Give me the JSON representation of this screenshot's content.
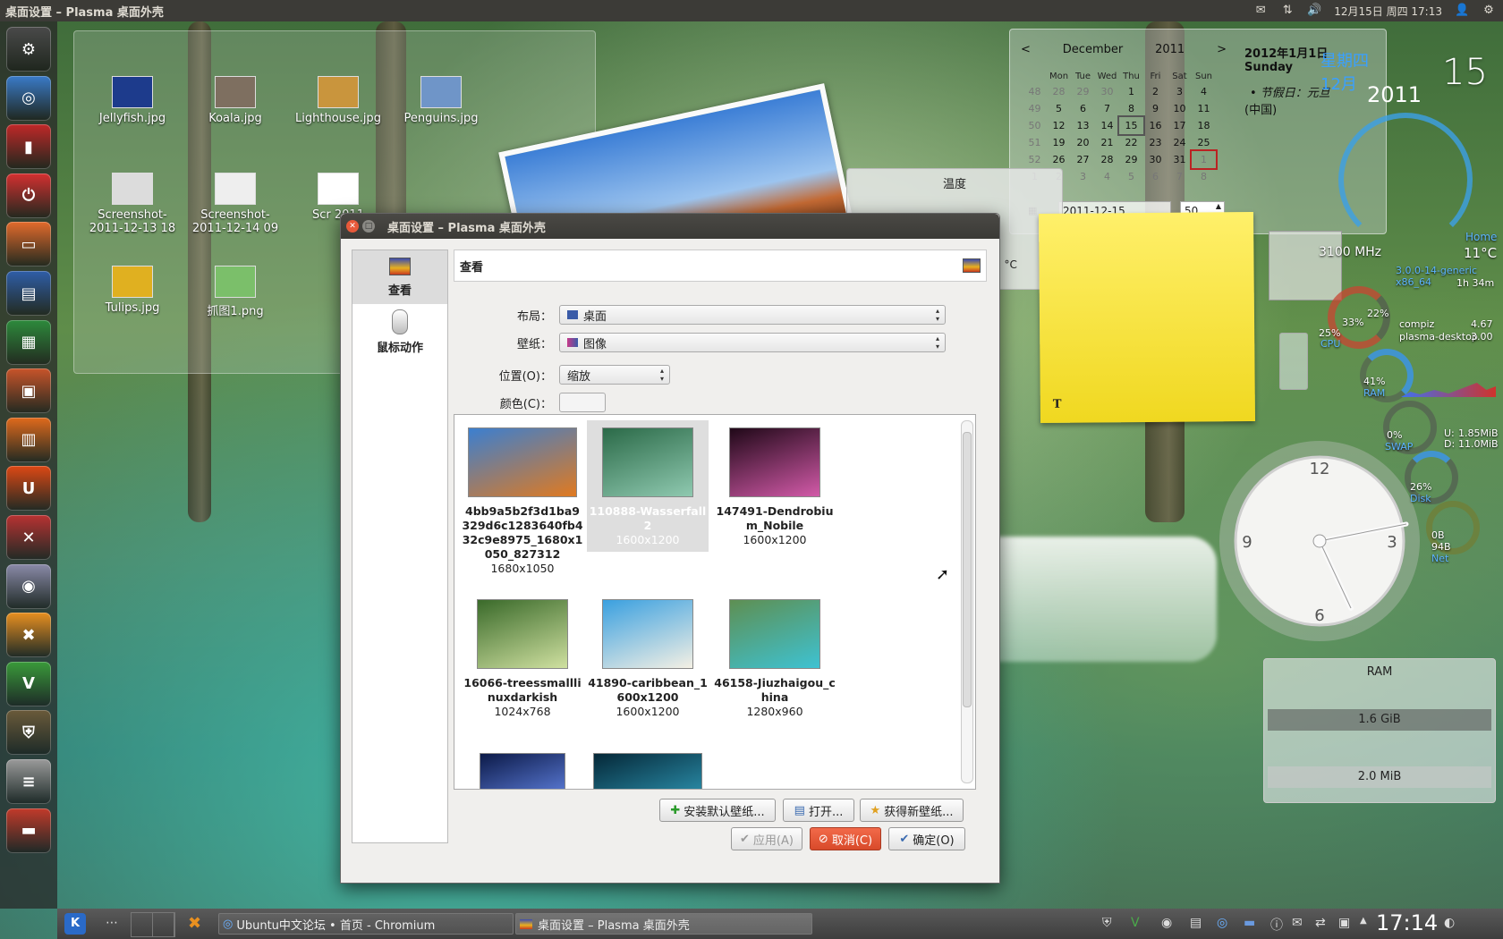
{
  "top_panel": {
    "title": "桌面设置 – Plasma 桌面外壳",
    "datetime": "12月15日 周四 17:13"
  },
  "desktop": {
    "files": [
      {
        "name": "Jellyfish.jpg",
        "color": "#1d3b8c"
      },
      {
        "name": "Koala.jpg",
        "color": "#7e6f60"
      },
      {
        "name": "Lighthouse.jpg",
        "color": "#c9953d"
      },
      {
        "name": "Penguins.jpg",
        "color": "#6f95c8"
      },
      {
        "name": "Screenshot-2011-12-13 18",
        "color": "#dcdcdc"
      },
      {
        "name": "Screenshot-2011-12-14 09",
        "color": "#eeeeee"
      },
      {
        "name": "Scr 2011",
        "color": "#ffffff"
      },
      {
        "name": "Tulips.jpg",
        "color": "#e0b020"
      },
      {
        "name": "抓图1.png",
        "color": "#7bbf6a"
      }
    ]
  },
  "calendar": {
    "month": "December",
    "year": "2011",
    "prev": "<",
    "next": ">",
    "weekdays": [
      "Mon",
      "Tue",
      "Wed",
      "Thu",
      "Fri",
      "Sat",
      "Sun"
    ],
    "weeks": [
      {
        "wk": "48",
        "days": [
          "28",
          "29",
          "30",
          "1",
          "2",
          "3",
          "4"
        ]
      },
      {
        "wk": "49",
        "days": [
          "5",
          "6",
          "7",
          "8",
          "9",
          "10",
          "11"
        ]
      },
      {
        "wk": "50",
        "days": [
          "12",
          "13",
          "14",
          "15",
          "16",
          "17",
          "18"
        ]
      },
      {
        "wk": "51",
        "days": [
          "19",
          "20",
          "21",
          "22",
          "23",
          "24",
          "25"
        ]
      },
      {
        "wk": "52",
        "days": [
          "26",
          "27",
          "28",
          "29",
          "30",
          "31",
          "1"
        ]
      },
      {
        "wk": "1",
        "days": [
          "2",
          "3",
          "4",
          "5",
          "6",
          "7",
          "8"
        ]
      }
    ],
    "event_date": "2012年1月1日",
    "event_weekday": "Sunday",
    "event_holiday": "• 节假日：元旦",
    "event_region": "(中国)",
    "date_input": "2011-12-15",
    "spin_value": "50",
    "overlay_weekday": "星期四",
    "overlay_month": "12月",
    "overlay_year": "2011",
    "overlay_day": "15"
  },
  "temperature": {
    "title": "温度",
    "unit": "0 °C"
  },
  "sysmon": {
    "freq": "3100 MHz",
    "home_label": "Home",
    "home_temp": "11°C",
    "kernel": "3.0.0-14-generic x86_64",
    "uptime": "1h 34m",
    "proc1_name": "compiz",
    "proc1_val": "4.67",
    "proc2_name": "plasma-desktop",
    "proc2_val": "3.00",
    "cpu1": "33%",
    "cpu2": "22%",
    "cpu3": "25%",
    "cpu_label": "CPU",
    "ram_pct": "41%",
    "ram_label": "RAM",
    "swap_pct": "0%",
    "swap_label": "SWAP",
    "up": "U:",
    "up_val": "1.85MiB",
    "down": "D:",
    "down_val": "11.0MiB",
    "disk_pct": "26%",
    "disk_label": "Disk",
    "net1": "0B",
    "net2": "94B",
    "net_label": "Net"
  },
  "ram_widget": {
    "title": "RAM",
    "used": "1.6 GiB",
    "swap": "2.0 MiB"
  },
  "dialog": {
    "title": "桌面设置 – Plasma 桌面外壳",
    "sidebar": [
      {
        "label": "查看"
      },
      {
        "label": "鼠标动作"
      }
    ],
    "header": "查看",
    "layout_label": "布局：",
    "layout_value": "桌面",
    "wallpaper_label": "壁纸：",
    "wallpaper_value": "图像",
    "position_label": "位置(O)：",
    "position_value": "缩放",
    "color_label": "颜色(C)：",
    "wallpapers": [
      {
        "name": "4bb9a5b2f3d1ba9329d6c1283640fb432c9e8975_1680x1050_827312",
        "size": "1680x1050",
        "colors": [
          "#3b7fd0",
          "#e07a20"
        ]
      },
      {
        "name": "110888-Wasserfall2",
        "size": "1600x1200",
        "colors": [
          "#2b6a48",
          "#8fc9b0"
        ],
        "selected": true
      },
      {
        "name": "147491-Dendrobium_Nobile",
        "size": "1600x1200",
        "colors": [
          "#200818",
          "#d25aa8"
        ]
      },
      {
        "name": "16066-treessmalllinuxdarkish",
        "size": "1024x768",
        "colors": [
          "#3a6a2a",
          "#cfe0a0"
        ]
      },
      {
        "name": "41890-caribbean_1600x1200",
        "size": "1600x1200",
        "colors": [
          "#3aa0e0",
          "#f4f0e4"
        ]
      },
      {
        "name": "46158-Jiuzhaigou_china",
        "size": "1280x960",
        "colors": [
          "#5e8f52",
          "#3ec2d2"
        ]
      },
      {
        "name": "",
        "size": "",
        "colors": [
          "#0c1a48",
          "#5a7ad6"
        ]
      },
      {
        "name": "",
        "size": "",
        "colors": [
          "#052838",
          "#2a8ca8"
        ]
      }
    ],
    "install_btn": "安装默认壁纸...",
    "open_btn": "打开...",
    "get_new_btn": "获得新壁纸...",
    "apply_btn": "应用(A)",
    "cancel_btn": "取消(C)",
    "ok_btn": "确定(O)"
  },
  "taskbar": {
    "task1": "Ubuntu中文论坛 • 首页 - Chromium",
    "task2": "桌面设置 – Plasma 桌面外壳",
    "time": "17:14"
  },
  "launcher": {
    "items": [
      {
        "name": "dash-home-icon",
        "color": "#4a4a4a",
        "glyph": "⚙"
      },
      {
        "name": "chromium-icon",
        "color": "#3a7bc8",
        "glyph": "◎"
      },
      {
        "name": "app-icon-red",
        "color": "#c02828",
        "glyph": "▮"
      },
      {
        "name": "shutdown-icon",
        "color": "#d43030",
        "glyph": "⏻"
      },
      {
        "name": "home-folder-icon",
        "color": "#e36b2c",
        "glyph": "▭"
      },
      {
        "name": "writer-icon",
        "color": "#2f5ea8",
        "glyph": "▤"
      },
      {
        "name": "calc-icon",
        "color": "#2d8a3c",
        "glyph": "▦"
      },
      {
        "name": "impress-icon",
        "color": "#c8542a",
        "glyph": "▣"
      },
      {
        "name": "software-center-icon",
        "color": "#e06a1c",
        "glyph": "▥"
      },
      {
        "name": "ubuntu-one-icon",
        "color": "#dd4814",
        "glyph": "U"
      },
      {
        "name": "system-settings-icon",
        "color": "#b83232",
        "glyph": "✕"
      },
      {
        "name": "webcam-icon",
        "color": "#8a8aa8",
        "glyph": "◉"
      },
      {
        "name": "xchat-icon",
        "color": "#e89020",
        "glyph": "✖"
      },
      {
        "name": "vim-icon",
        "color": "#3a9a3a",
        "glyph": "V"
      },
      {
        "name": "shield-icon",
        "color": "#6a5a3a",
        "glyph": "⛨"
      },
      {
        "name": "drives-icon",
        "color": "#9a9a9a",
        "glyph": "≡"
      },
      {
        "name": "workspace-icon",
        "color": "#c23a2a",
        "glyph": "▬"
      }
    ]
  }
}
